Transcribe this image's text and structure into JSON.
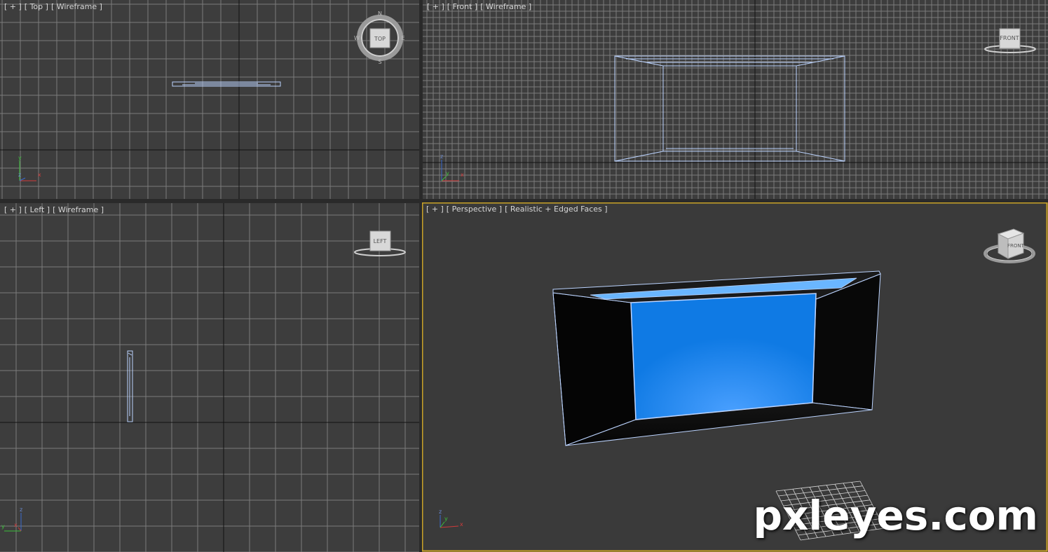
{
  "viewports": {
    "top": {
      "plus": "[ + ]",
      "view": "[ Top ]",
      "shading": "[ Wireframe ]",
      "cube_label": "TOP",
      "compass": [
        "N",
        "E",
        "S",
        "W"
      ]
    },
    "front": {
      "plus": "[ + ]",
      "view": "[ Front ]",
      "shading": "[ Wireframe ]",
      "cube_label": "FRONT"
    },
    "left": {
      "plus": "[ + ]",
      "view": "[ Left ]",
      "shading": "[ Wireframe ]",
      "cube_label": "LEFT"
    },
    "persp": {
      "plus": "[ + ]",
      "view": "[ Perspective ]",
      "shading": "[ Realistic + Edged Faces ]",
      "cube_label": "FRONT"
    }
  },
  "axes": {
    "top": [
      "y",
      "z",
      "x"
    ],
    "front": [
      "z",
      "y",
      "x"
    ],
    "left": [
      "z",
      "x",
      "y"
    ],
    "persp": [
      "z",
      "y",
      "x"
    ]
  },
  "colors": {
    "grid_bg": "#3d3d3d",
    "grid_line": "#8a8a8a",
    "wire": "#bcd4ff",
    "active_border": "#c9a227",
    "screen_blue": "#0f7ae4",
    "axis_x": "#d03a3a",
    "axis_y": "#3ac03a",
    "axis_z": "#3a6ad0"
  },
  "watermark": "pxleyes.com"
}
